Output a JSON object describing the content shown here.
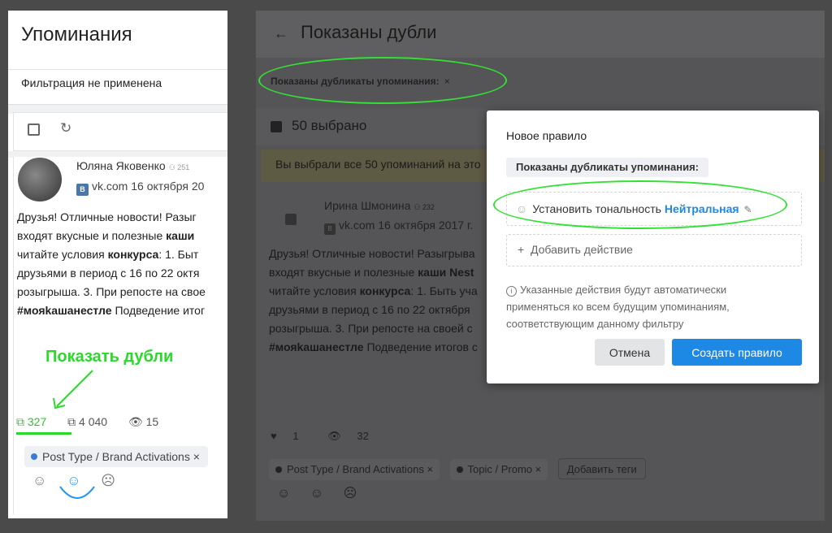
{
  "left": {
    "title": "Упоминания",
    "filter_text": "Фильтрация не применена",
    "post": {
      "author": "Юляна Яковенко",
      "author_count": "251",
      "source": "vk.com 16 октября 20",
      "lines": [
        "Друзья! Отличные новости! Разыг",
        "входят вкусные и полезные ",
        "читайте условия ",
        "друзьями в период с 16 по 22 октя",
        "розыгрыша. 3. При репосте на свое",
        "Подведение итог"
      ],
      "bold_kashi": "каши",
      "bold_konkurs": "конкурса",
      "tail_konkurs": ": 1. Быт",
      "hashtag": "#мояkашанестле"
    },
    "annotation": "Показать дубли",
    "stats": {
      "duplicates": "327",
      "reposts": "4 040",
      "views": "15"
    },
    "tag": "Post Type / Brand Activations",
    "tag_close": "×",
    "vk_icon": "В"
  },
  "right": {
    "back": "←",
    "title": "Показаны дубли",
    "chip": "Показаны дубликаты упоминания:",
    "chip_close": "×",
    "selected": "50 выбрано",
    "notice": "Вы выбрали все 50 упоминаний на это",
    "post": {
      "author": "Ирина Шмонина",
      "author_count": "232",
      "source": "vk.com 16 октября 2017 г.",
      "lines": [
        "Друзья! Отличные новости! Разыгрыва",
        "входят вкусные и полезные ",
        "читайте условия ",
        "друзьями в период с 16 по 22 октября",
        "розыгрыша. 3. При репосте на своей с",
        "Подведение итогов с"
      ],
      "bold_kashi": "каши Nest",
      "bold_konkurs": "конкурса",
      "tail_konkurs": ": 1. Быть уча",
      "hashtag": "#мояkашанестле"
    },
    "likes": "1",
    "views": "32",
    "tags": [
      "Post Type / Brand Activations",
      "Topic / Promo"
    ],
    "add_tags": "Добавить теги"
  },
  "modal": {
    "title": "Новое правило",
    "chip": "Показаны дубликаты упоминания:",
    "action_label": "Установить тональность",
    "action_value": "Нейтральная",
    "add_action": "Добавить действие",
    "info": "Указанные действия будут автоматически применяться ко всем будущим упоминаниям, соответствующим данному фильтру",
    "cancel": "Отмена",
    "create": "Создать правило"
  },
  "colors": {
    "accent": "#1e88e5",
    "annotation": "#2bd92b"
  }
}
